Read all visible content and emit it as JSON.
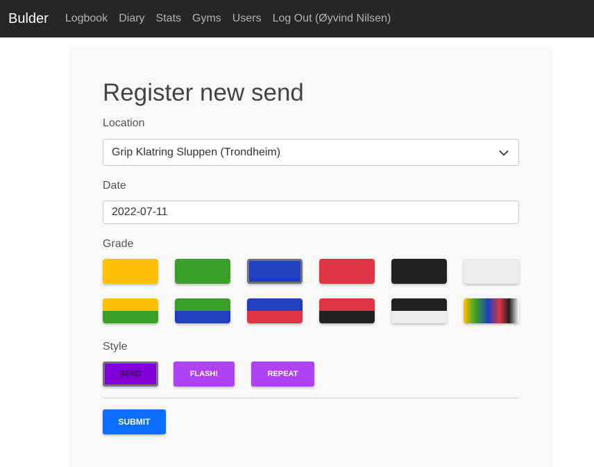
{
  "navbar": {
    "brand": "Bulder",
    "links": [
      {
        "label": "Logbook"
      },
      {
        "label": "Diary"
      },
      {
        "label": "Stats"
      },
      {
        "label": "Gyms"
      },
      {
        "label": "Users"
      },
      {
        "label": "Log Out (Øyvind Nilsen)"
      }
    ]
  },
  "form": {
    "title": "Register new send",
    "location": {
      "label": "Location",
      "value": "Grip Klatring Sluppen (Trondheim)",
      "icon": "chevron-down-icon"
    },
    "date": {
      "label": "Date",
      "value": "2022-07-11"
    },
    "grade": {
      "label": "Grade",
      "colors": {
        "yellow": "#ffc107",
        "green": "#3aa02a",
        "blue": "#1f3fbf",
        "red": "#dc3545",
        "black": "#212121",
        "white": "#ececec"
      },
      "selected": "blue",
      "row1": [
        "yellow",
        "green",
        "blue",
        "red",
        "black",
        "white"
      ],
      "row2": [
        "yellow-green",
        "green-blue",
        "blue-red",
        "red-black",
        "black-white",
        "rainbow"
      ]
    },
    "style": {
      "label": "Style",
      "selected": "send",
      "color": "#b042f5",
      "selected_color": "#8200d9",
      "options": [
        {
          "id": "send",
          "label": "SEND"
        },
        {
          "id": "flash",
          "label": "FLASH!"
        },
        {
          "id": "repeat",
          "label": "REPEAT"
        }
      ]
    },
    "submit_label": "SUBMIT",
    "submit_color": "#0d6efd"
  }
}
